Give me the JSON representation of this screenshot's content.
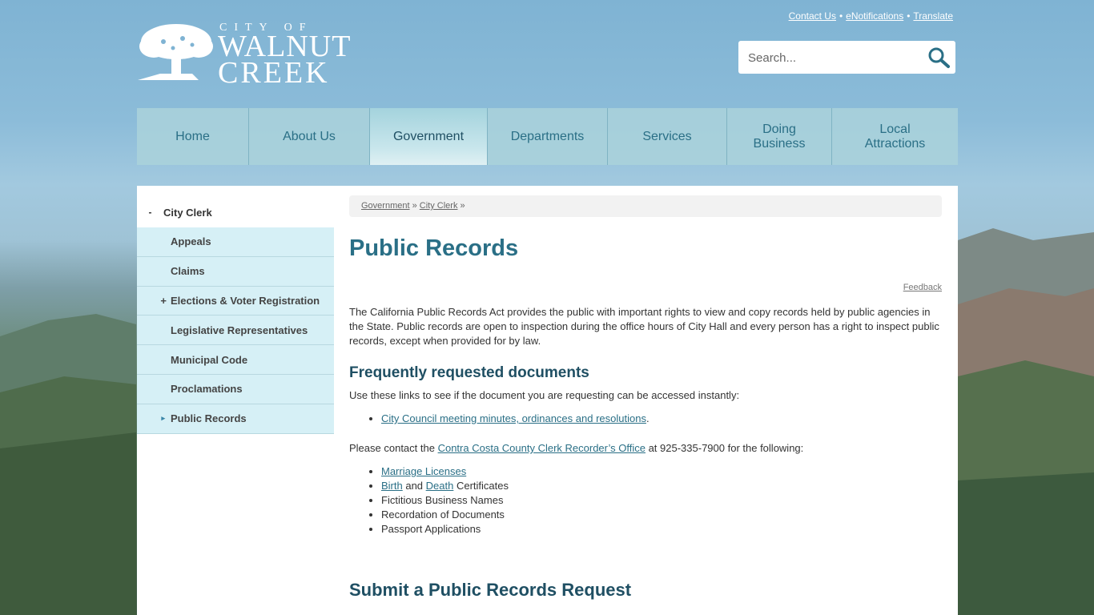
{
  "logo": {
    "line1": "CITY OF",
    "line2": "WALNUT",
    "line3": "CREEK"
  },
  "toplinks": [
    "Contact Us",
    "eNotifications",
    "Translate"
  ],
  "search": {
    "placeholder": "Search..."
  },
  "nav": [
    "Home",
    "About Us",
    "Government",
    "Departments",
    "Services",
    "Doing Business",
    "Local Attractions"
  ],
  "nav_active": "Government",
  "sidenav": {
    "head": "City Clerk",
    "head_mark": "-",
    "items": [
      {
        "label": "Appeals",
        "mark": ""
      },
      {
        "label": "Claims",
        "mark": ""
      },
      {
        "label": "Elections & Voter Registration",
        "mark": "+"
      },
      {
        "label": "Legislative Representatives",
        "mark": ""
      },
      {
        "label": "Municipal Code",
        "mark": ""
      },
      {
        "label": "Proclamations",
        "mark": ""
      },
      {
        "label": "Public Records",
        "mark": "▸"
      }
    ]
  },
  "breadcrumb": {
    "crumb1": "Government",
    "sep1": "»",
    "crumb2": "City Clerk",
    "sep2": "»"
  },
  "page": {
    "title": "Public Records",
    "feedback": "Feedback",
    "intro": "The California Public Records Act provides the public with important rights to view and copy records held by public agencies in the State. Public records are open to inspection during the office hours of City Hall and every person has a right to inspect public records, except when provided for by law.",
    "h2_frequent": "Frequently requested documents",
    "frequent_text": "Use these links to see if the document you are requesting can be accessed instantly:",
    "frequent_link": "City Council meeting minutes, ordinances and resolutions",
    "frequent_link_end": ".",
    "contact_pre": "Please contact the ",
    "contact_link": "Contra Costa County Clerk Recorder’s Office",
    "contact_post": " at 925-335-7900 for the following:",
    "list": {
      "marriage": "Marriage Licenses",
      "birth": "Birth",
      "and": " and ",
      "death": "Death",
      "certificates": " Certificates",
      "fictitious": "Fictitious Business Names",
      "recordation": "Recordation of Documents",
      "passport": "Passport Applications"
    },
    "h2_submit": "Submit a Public Records Request"
  }
}
